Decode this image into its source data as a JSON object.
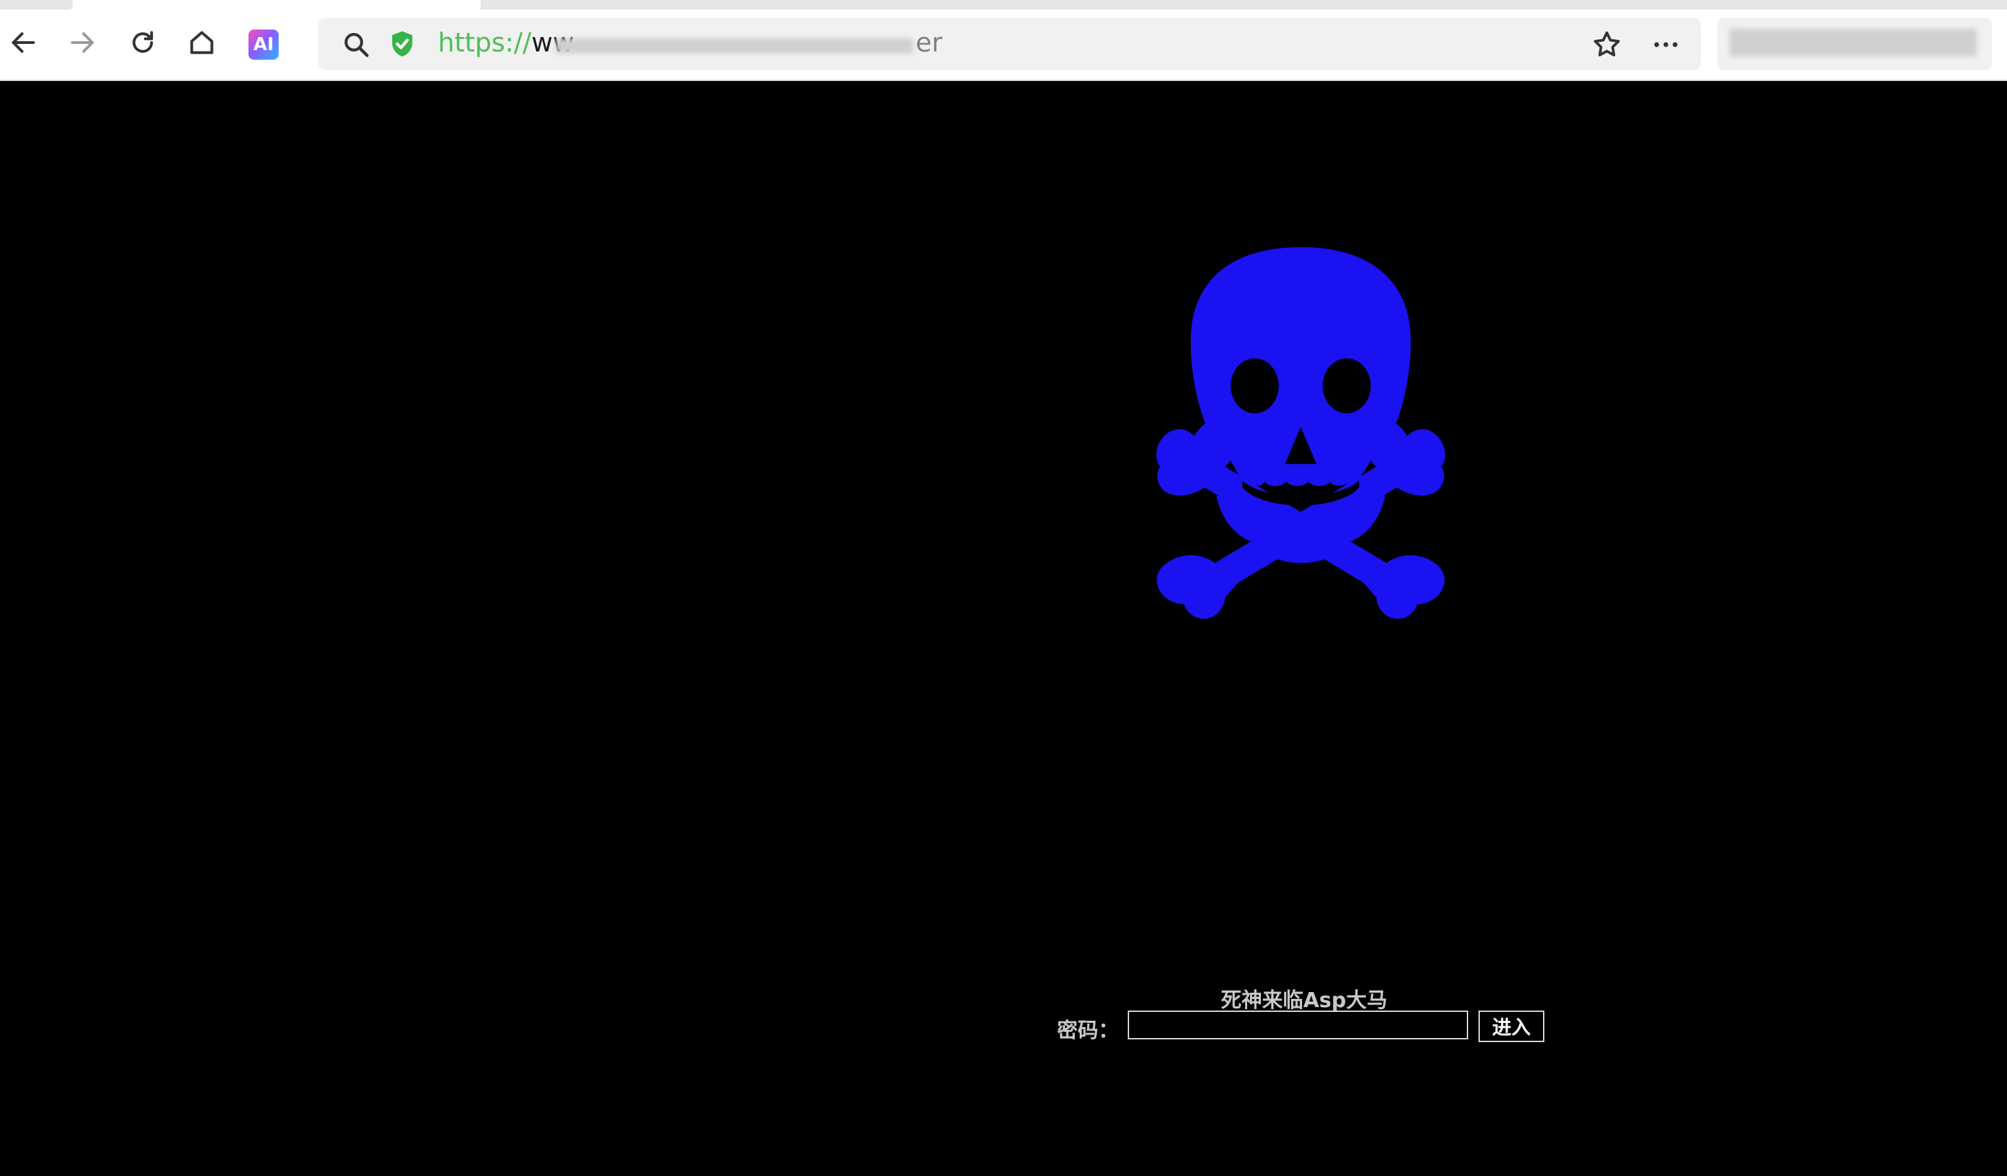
{
  "browser": {
    "url_visible_prefix": "https://",
    "url_visible_host_start": "ww",
    "url_visible_tail": "er",
    "ai_badge": "AI",
    "icons": {
      "back": "back-arrow-icon",
      "forward": "forward-arrow-icon",
      "reload": "reload-icon",
      "home": "home-icon",
      "search": "search-icon",
      "security": "shield-check-icon",
      "bookmark": "star-icon",
      "menu": "more-dots-icon"
    }
  },
  "page": {
    "background": "#000000",
    "skull_color": "#1a12f0",
    "title": "死神来临Asp大马",
    "password_label": "密码：",
    "password_value": "",
    "submit_label": "进入"
  }
}
